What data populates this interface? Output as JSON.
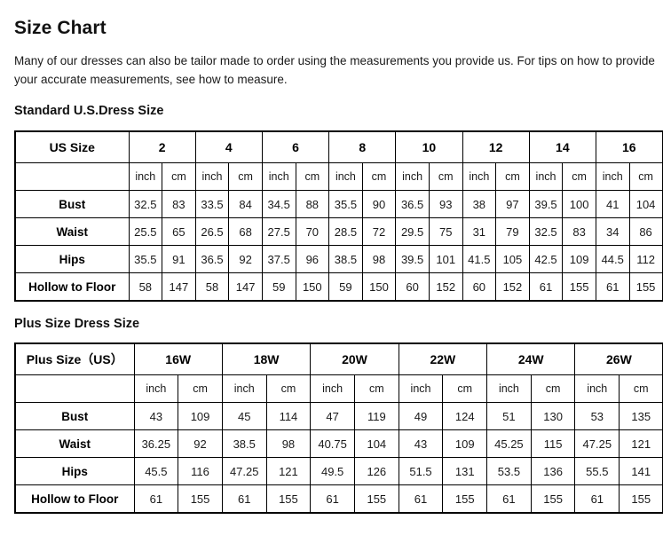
{
  "page": {
    "title": "Size Chart",
    "intro": "Many of our dresses can also be tailor made to order using the measurements you provide us. For tips on how to provide your accurate measurements, see how to measure."
  },
  "standard": {
    "heading": "Standard U.S.Dress Size",
    "corner_label": "US Size",
    "sizes": [
      "2",
      "4",
      "6",
      "8",
      "10",
      "12",
      "14",
      "16"
    ],
    "units": [
      "inch",
      "cm"
    ],
    "rows": [
      {
        "label": "Bust",
        "values": [
          "32.5",
          "83",
          "33.5",
          "84",
          "34.5",
          "88",
          "35.5",
          "90",
          "36.5",
          "93",
          "38",
          "97",
          "39.5",
          "100",
          "41",
          "104"
        ]
      },
      {
        "label": "Waist",
        "values": [
          "25.5",
          "65",
          "26.5",
          "68",
          "27.5",
          "70",
          "28.5",
          "72",
          "29.5",
          "75",
          "31",
          "79",
          "32.5",
          "83",
          "34",
          "86"
        ]
      },
      {
        "label": "Hips",
        "values": [
          "35.5",
          "91",
          "36.5",
          "92",
          "37.5",
          "96",
          "38.5",
          "98",
          "39.5",
          "101",
          "41.5",
          "105",
          "42.5",
          "109",
          "44.5",
          "112"
        ]
      },
      {
        "label": "Hollow to Floor",
        "values": [
          "58",
          "147",
          "58",
          "147",
          "59",
          "150",
          "59",
          "150",
          "60",
          "152",
          "60",
          "152",
          "61",
          "155",
          "61",
          "155"
        ]
      }
    ]
  },
  "plus": {
    "heading": "Plus Size Dress Size",
    "corner_label": "Plus Size（US）",
    "sizes": [
      "16W",
      "18W",
      "20W",
      "22W",
      "24W",
      "26W"
    ],
    "units": [
      "inch",
      "cm"
    ],
    "rows": [
      {
        "label": "Bust",
        "values": [
          "43",
          "109",
          "45",
          "114",
          "47",
          "119",
          "49",
          "124",
          "51",
          "130",
          "53",
          "135"
        ]
      },
      {
        "label": "Waist",
        "values": [
          "36.25",
          "92",
          "38.5",
          "98",
          "40.75",
          "104",
          "43",
          "109",
          "45.25",
          "115",
          "47.25",
          "121"
        ]
      },
      {
        "label": "Hips",
        "values": [
          "45.5",
          "116",
          "47.25",
          "121",
          "49.5",
          "126",
          "51.5",
          "131",
          "53.5",
          "136",
          "55.5",
          "141"
        ]
      },
      {
        "label": "Hollow to Floor",
        "values": [
          "61",
          "155",
          "61",
          "155",
          "61",
          "155",
          "61",
          "155",
          "61",
          "155",
          "61",
          "155"
        ]
      }
    ]
  }
}
